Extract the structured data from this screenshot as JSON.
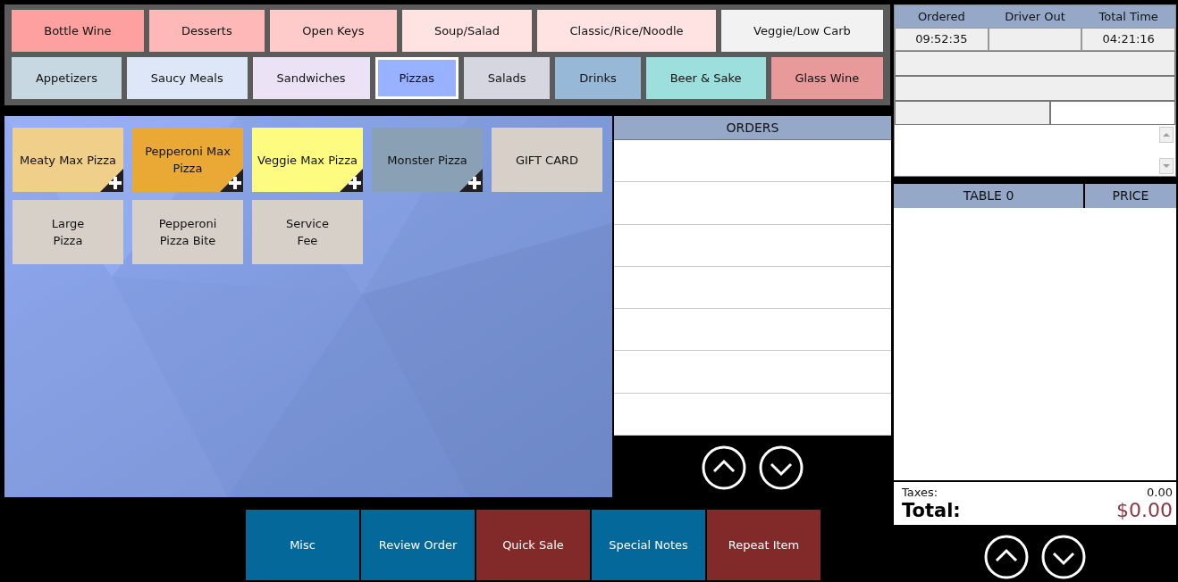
{
  "categories": [
    [
      {
        "label": "Bottle Wine",
        "color": "#ffa0a0",
        "selected": false
      },
      {
        "label": "Desserts",
        "color": "#ffb8b8",
        "selected": false
      },
      {
        "label": "Open Keys",
        "color": "#ffcaca",
        "selected": false
      },
      {
        "label": "Soup/Salad",
        "color": "#ffe2e2",
        "selected": false
      },
      {
        "label": "Classic/Rice/Noodle",
        "color": "#ffe2e2",
        "selected": false
      },
      {
        "label": "Veggie/Low Carb",
        "color": "#f2f2f2",
        "selected": false
      }
    ],
    [
      {
        "label": "Appetizers",
        "color": "#c8d8e2",
        "selected": false
      },
      {
        "label": "Saucy Meals",
        "color": "#dde7f7",
        "selected": false
      },
      {
        "label": "Sandwiches",
        "color": "#ebe2f6",
        "selected": false
      },
      {
        "label": "Pizzas",
        "color": "#98b2ff",
        "selected": true
      },
      {
        "label": "Salads",
        "color": "#d6d6e0",
        "selected": false
      },
      {
        "label": "Drinks",
        "color": "#98b8d8",
        "selected": false
      },
      {
        "label": "Beer & Sake",
        "color": "#9ddfdc",
        "selected": false
      },
      {
        "label": "Glass Wine",
        "color": "#e89a9a",
        "selected": false
      }
    ]
  ],
  "menu_items": [
    {
      "label": "Meaty Max Pizza",
      "color": "#f0cf8a",
      "has_options": true
    },
    {
      "label": "Pepperoni Max Pizza",
      "color": "#eaa935",
      "has_options": true
    },
    {
      "label": "Veggie Max Pizza",
      "color": "#fdfc80",
      "has_options": true
    },
    {
      "label": "Monster Pizza",
      "color": "#8aa0b4",
      "has_options": true
    },
    {
      "label": "GIFT CARD",
      "color": "#d6d0c9",
      "has_options": false
    },
    {
      "label": "Large\nPizza",
      "color": "#d6d0c9",
      "has_options": false
    },
    {
      "label": "Pepperoni\nPizza Bite",
      "color": "#d6d0c9",
      "has_options": false
    },
    {
      "label": "Service\nFee",
      "color": "#d6d0c9",
      "has_options": false
    }
  ],
  "orders": {
    "title": "ORDERS"
  },
  "order_info": {
    "columns": [
      "Ordered",
      "Driver Out",
      "Total Time"
    ],
    "ordered": "09:52:35",
    "total_time": "04:21:16"
  },
  "ticket": {
    "columns": [
      "TABLE 0",
      "PRICE"
    ],
    "taxes_label": "Taxes:",
    "taxes": "0.00",
    "total_label": "Total:",
    "total": "$0.00"
  },
  "actions": [
    {
      "label": "Misc",
      "color": "#05689a"
    },
    {
      "label": "Review Order",
      "color": "#05689a"
    },
    {
      "label": "Quick Sale",
      "color": "#822a2a"
    },
    {
      "label": "Special Notes",
      "color": "#05689a"
    },
    {
      "label": "Repeat Item",
      "color": "#822a2a"
    }
  ]
}
